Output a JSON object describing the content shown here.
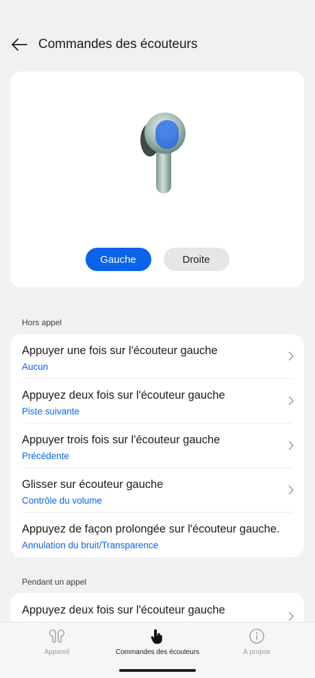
{
  "header": {
    "title": "Commandes des écouteurs"
  },
  "preview": {
    "side_buttons": {
      "left": "Gauche",
      "right": "Droite"
    },
    "selected": "left"
  },
  "sections": [
    {
      "label": "Hors appel",
      "rows": [
        {
          "title": "Appuyer une fois sur l'écouteur gauche",
          "value": "Aucun"
        },
        {
          "title": "Appuyez deux fois sur l'écouteur gauche",
          "value": "Piste suivante"
        },
        {
          "title": "Appuyer trois fois sur l'écouteur gauche",
          "value": "Précédente"
        },
        {
          "title": "Glisser sur écouteur gauche",
          "value": "Contrôle du volume"
        },
        {
          "title": "Appuyez de façon prolongée sur l'écouteur gauche.",
          "value": "Annulation du bruit/Transparence"
        }
      ]
    },
    {
      "label": "Pendant un appel",
      "rows": [
        {
          "title": "Appuyez deux fois sur l'écouteur gauche"
        }
      ]
    }
  ],
  "bottom_nav": [
    {
      "label": "Appareil",
      "icon": "earbuds-icon",
      "active": false
    },
    {
      "label": "Commandes des écouteurs",
      "icon": "touch-hand-icon",
      "active": true
    },
    {
      "label": "À propos",
      "icon": "info-icon",
      "active": false
    }
  ],
  "colors": {
    "accent": "#0a63e9",
    "background": "#f1f1f3",
    "card": "#ffffff"
  }
}
